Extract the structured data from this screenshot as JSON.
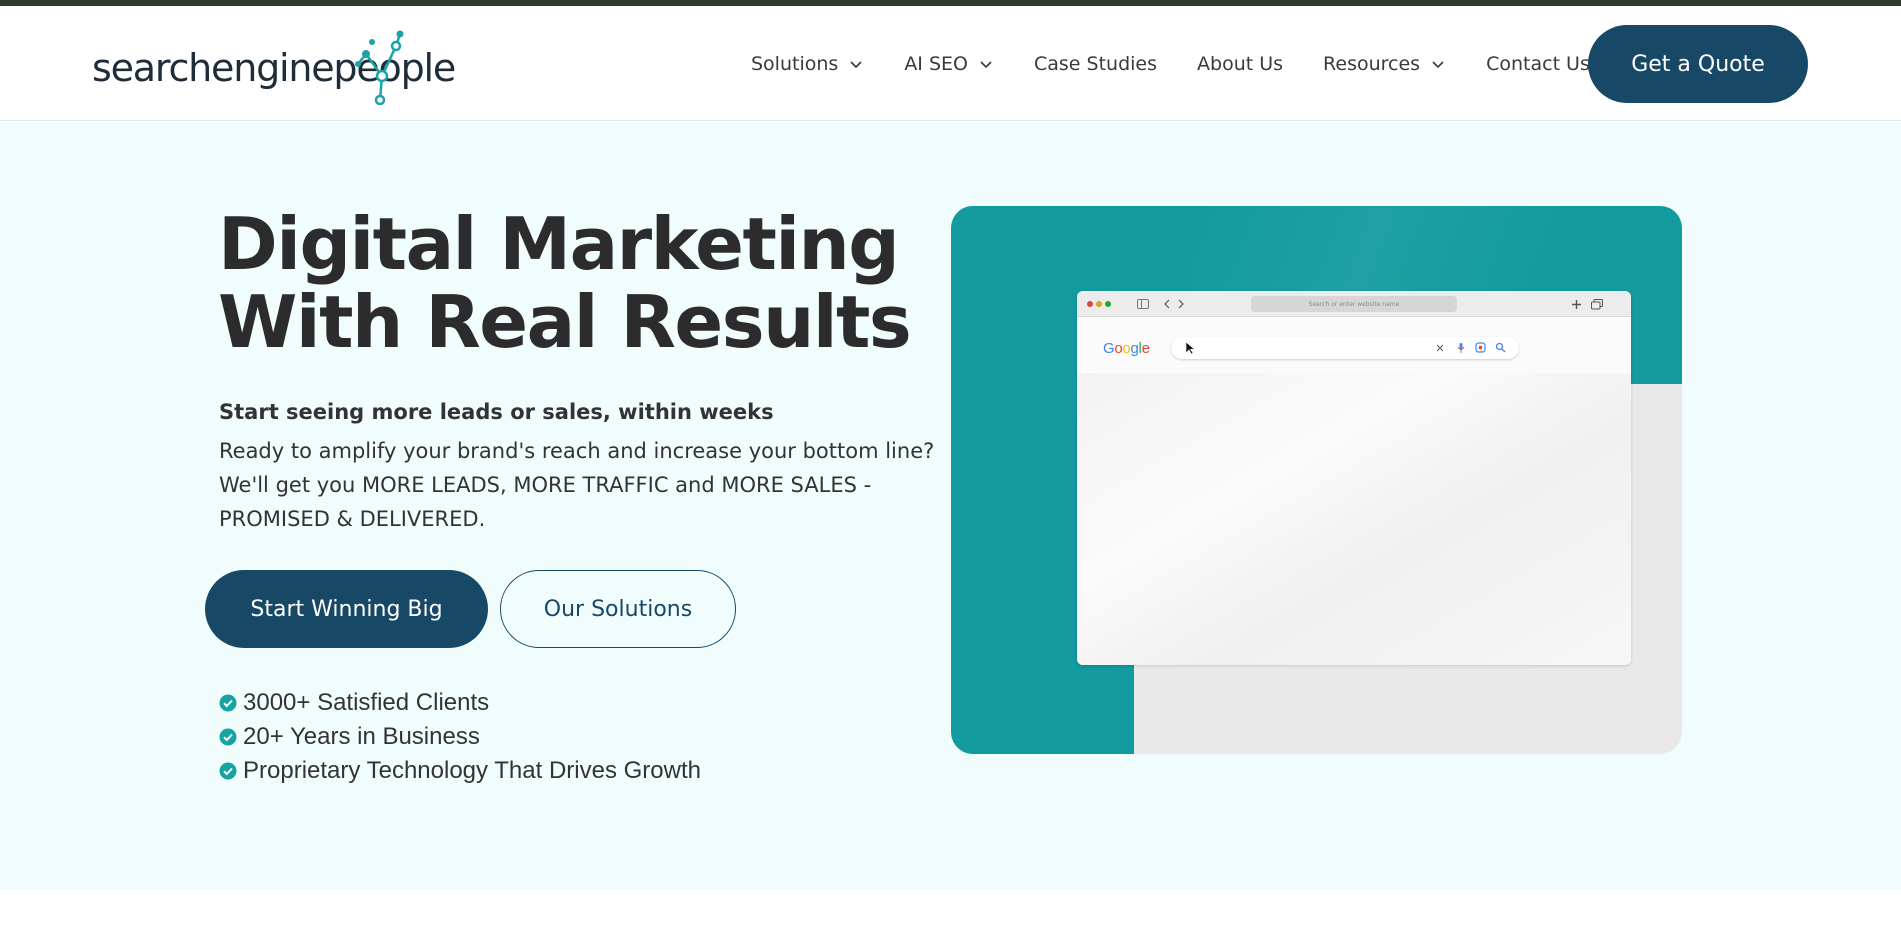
{
  "header": {
    "logo": {
      "text": "searchenginepeople",
      "icon": "molecule-network-logo-icon"
    },
    "nav": [
      {
        "label": "Solutions",
        "has_dropdown": true
      },
      {
        "label": "AI SEO",
        "has_dropdown": true
      },
      {
        "label": "Case Studies",
        "has_dropdown": false
      },
      {
        "label": "About Us",
        "has_dropdown": false
      },
      {
        "label": "Resources",
        "has_dropdown": true
      },
      {
        "label": "Contact Us",
        "has_dropdown": false
      }
    ],
    "cta_label": "Get a Quote"
  },
  "hero": {
    "headline_bold": "Digital Marketing",
    "headline_light": "With Real Results",
    "lead_strong": "Start seeing more leads or sales, within weeks",
    "lead_body": "Ready to amplify your brand's reach and increase your bottom line? We'll get you MORE LEADS, MORE TRAFFIC and MORE SALES - PROMISED & DELIVERED.",
    "primary_button": "Start Winning Big",
    "secondary_button": "Our Solutions",
    "checklist": [
      "3000+ Satisfied Clients",
      "20+ Years in Business",
      "Proprietary Technology That Drives Growth"
    ],
    "media": {
      "browser_address_placeholder": "Search or enter website name",
      "search_brand": "Google",
      "icons": [
        "clear-icon",
        "microphone-icon",
        "lens-icon",
        "search-icon",
        "plus-icon",
        "tabs-icon",
        "sidebar-icon",
        "back-icon",
        "forward-icon",
        "cursor-icon"
      ]
    }
  },
  "colors": {
    "brand_navy": "#174866",
    "teal": "#129a9e",
    "hero_bg": "#f1fdfd",
    "check_teal": "#17a3a3"
  }
}
